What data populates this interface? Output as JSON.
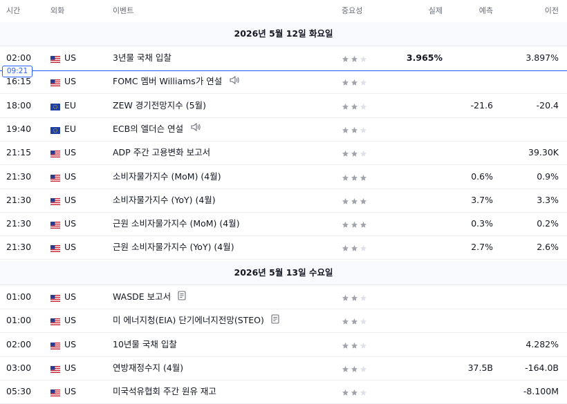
{
  "header": {
    "time": "시간",
    "currency": "외화",
    "event": "이벤트",
    "importance": "중요성",
    "actual": "실제",
    "forecast": "예측",
    "previous": "이전"
  },
  "now_marker": "09:21",
  "days": [
    {
      "date": "2026년 5월 12일 화요일",
      "events": [
        {
          "time": "02:00",
          "country": "US",
          "event": "3년물 국채 입찰",
          "stars": 2,
          "actual": "3.965%",
          "forecast": "",
          "previous": "3.897%",
          "icon": ""
        },
        {
          "time": "16:15",
          "country": "US",
          "event": "FOMC 멤버 Williams가 연설",
          "stars": 2,
          "actual": "",
          "forecast": "",
          "previous": "",
          "icon": "speaker-icon"
        },
        {
          "time": "18:00",
          "country": "EU",
          "event": "ZEW 경기전망지수 (5월)",
          "stars": 2,
          "actual": "",
          "forecast": "-21.6",
          "previous": "-20.4",
          "icon": ""
        },
        {
          "time": "19:40",
          "country": "EU",
          "event": "ECB의 엘더슨 연설",
          "stars": 2,
          "actual": "",
          "forecast": "",
          "previous": "",
          "icon": "speaker-icon"
        },
        {
          "time": "21:15",
          "country": "US",
          "event": "ADP 주간 고용변화 보고서",
          "stars": 2,
          "actual": "",
          "forecast": "",
          "previous": "39.30K",
          "icon": ""
        },
        {
          "time": "21:30",
          "country": "US",
          "event": "소비자물가지수 (MoM) (4월)",
          "stars": 3,
          "actual": "",
          "forecast": "0.6%",
          "previous": "0.9%",
          "icon": ""
        },
        {
          "time": "21:30",
          "country": "US",
          "event": "소비자물가지수 (YoY) (4월)",
          "stars": 3,
          "actual": "",
          "forecast": "3.7%",
          "previous": "3.3%",
          "icon": ""
        },
        {
          "time": "21:30",
          "country": "US",
          "event": "근원 소비자물가지수 (MoM) (4월)",
          "stars": 3,
          "actual": "",
          "forecast": "0.3%",
          "previous": "0.2%",
          "icon": ""
        },
        {
          "time": "21:30",
          "country": "US",
          "event": "근원 소비자물가지수 (YoY) (4월)",
          "stars": 2,
          "actual": "",
          "forecast": "2.7%",
          "previous": "2.6%",
          "icon": ""
        }
      ]
    },
    {
      "date": "2026년 5월 13일 수요일",
      "events": [
        {
          "time": "01:00",
          "country": "US",
          "event": "WASDE 보고서",
          "stars": 2,
          "actual": "",
          "forecast": "",
          "previous": "",
          "icon": "document-icon"
        },
        {
          "time": "01:00",
          "country": "US",
          "event": "미 에너지청(EIA) 단기에너지전망(STEO)",
          "stars": 2,
          "actual": "",
          "forecast": "",
          "previous": "",
          "icon": "document-icon"
        },
        {
          "time": "02:00",
          "country": "US",
          "event": "10년물 국채 입찰",
          "stars": 2,
          "actual": "",
          "forecast": "",
          "previous": "4.282%",
          "icon": ""
        },
        {
          "time": "03:00",
          "country": "US",
          "event": "연방재정수지 (4월)",
          "stars": 2,
          "actual": "",
          "forecast": "37.5B",
          "previous": "-164.0B",
          "icon": ""
        },
        {
          "time": "05:30",
          "country": "US",
          "event": "미국석유협회 주간 원유 재고",
          "stars": 2,
          "actual": "",
          "forecast": "",
          "previous": "-8.100M",
          "icon": ""
        }
      ]
    }
  ],
  "colors": {
    "star_on": "#a0a3ab",
    "star_off": "#dfe1e6",
    "now_line": "#2962ff"
  }
}
